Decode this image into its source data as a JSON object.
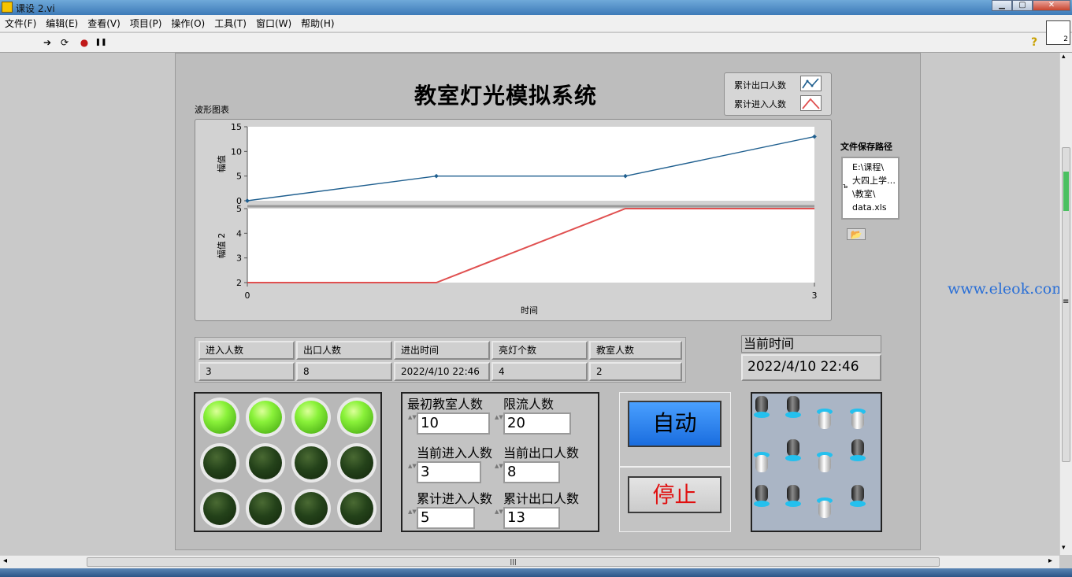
{
  "window": {
    "title": "课设 2.vi",
    "min": "▁",
    "max": "▢",
    "close": "✕"
  },
  "menu": [
    "文件(F)",
    "编辑(E)",
    "查看(V)",
    "项目(P)",
    "操作(O)",
    "工具(T)",
    "窗口(W)",
    "帮助(H)"
  ],
  "toolbar": {
    "run": "➔",
    "run_cont": "⟳",
    "abort": "●",
    "pause": "❚❚",
    "help": "?",
    "vi_icon_num": "2"
  },
  "panel_title": "教室灯光模拟系统",
  "legend": [
    {
      "name": "累计出口人数",
      "color": "#1f5f8f"
    },
    {
      "name": "累计进入人数",
      "color": "#e05050"
    }
  ],
  "chart_label": "波形图表",
  "chart_data": {
    "type": "line",
    "x": [
      0,
      1,
      2,
      3
    ],
    "xlim": [
      0,
      3
    ],
    "xlabel": "时间",
    "xticks": [
      "0",
      "3"
    ],
    "plots": [
      {
        "ylabel": "幅值",
        "ylim": [
          0,
          15
        ],
        "yticks": [
          "15",
          "10",
          "5",
          "0"
        ],
        "series": [
          {
            "name": "累计出口人数",
            "values": [
              0,
              5,
              5,
              13
            ],
            "color": "#1f5f8f",
            "markers": true
          }
        ]
      },
      {
        "ylabel": "幅值 2",
        "ylim": [
          2,
          5
        ],
        "yticks": [
          "5",
          "4",
          "3",
          "2"
        ],
        "series": [
          {
            "name": "累计进入人数",
            "values": [
              2,
              2,
              5,
              5
            ],
            "color": "#e05050",
            "markers": false
          }
        ]
      }
    ]
  },
  "file": {
    "label": "文件保存路径",
    "lines": [
      "E:\\课程\\",
      "大四上学…",
      "\\教室\\",
      "data.xls"
    ],
    "prefix": "ъ",
    "browse": "📂"
  },
  "table": {
    "headers": [
      "进入人数",
      "出口人数",
      "进出时间",
      "亮灯个数",
      "教室人数"
    ],
    "row": [
      "3",
      "8",
      "2022/4/10 22:46",
      "4",
      "2"
    ]
  },
  "clock": {
    "label": "当前时间",
    "value": "2022/4/10 22:46"
  },
  "leds": [
    true,
    true,
    true,
    true,
    false,
    false,
    false,
    false,
    false,
    false,
    false,
    false
  ],
  "numeric": {
    "initial_label": "最初教室人数",
    "initial_value": "10",
    "limit_label": "限流人数",
    "limit_value": "20",
    "cur_in_label": "当前进入人数",
    "cur_in_value": "3",
    "cur_out_label": "当前出口人数",
    "cur_out_value": "8",
    "total_in_label": "累计进入人数",
    "total_in_value": "5",
    "total_out_label": "累计出口人数",
    "total_out_value": "13",
    "spin": "▲▼"
  },
  "buttons": {
    "auto": "自动",
    "stop": "停止"
  },
  "switches": [
    "up",
    "up",
    "dn",
    "dn",
    "dn",
    "up",
    "dn",
    "up",
    "up",
    "up",
    "dn",
    "up"
  ],
  "watermark": "www.eleok.com",
  "scroll": {
    "grip": "|||",
    "left": "◂",
    "right": "▸",
    "up": "▴",
    "down": "▾",
    "vgrip": "≡"
  }
}
